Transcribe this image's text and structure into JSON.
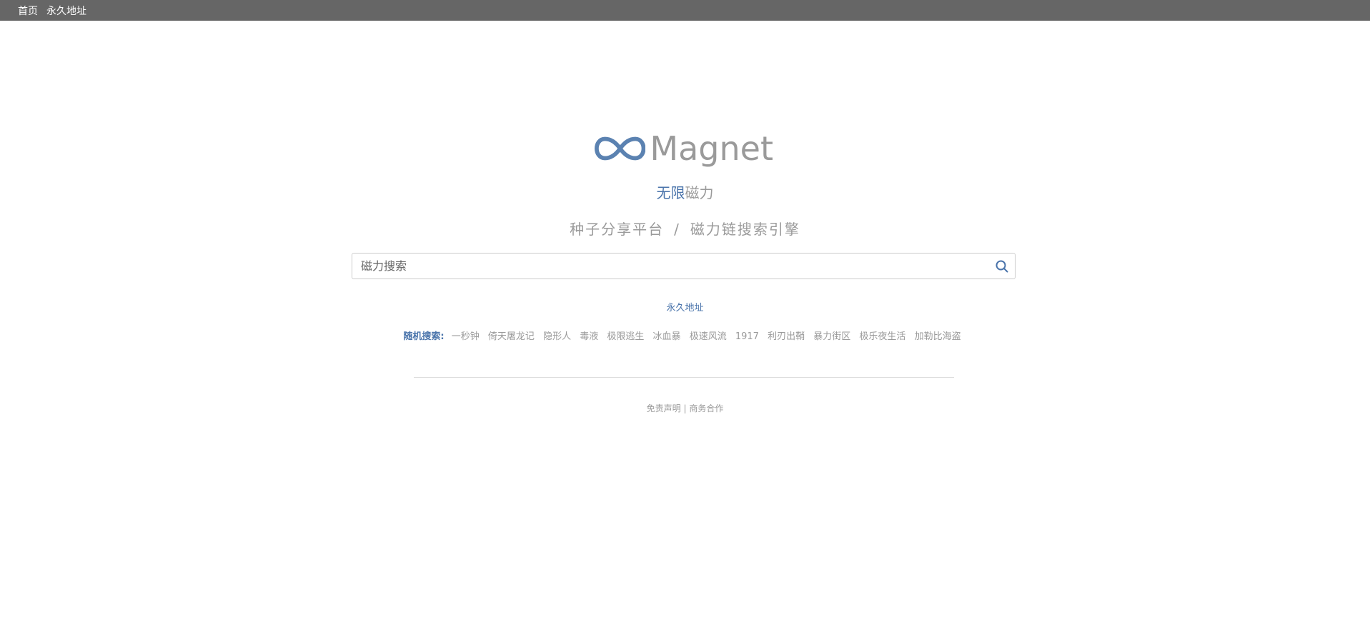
{
  "topbar": {
    "links": [
      "首页",
      "永久地址"
    ]
  },
  "logo": {
    "text": "Magnet",
    "icon": "infinity-icon",
    "icon_color": "#5b82b1"
  },
  "slogan": {
    "part1": "无限",
    "part2": "磁力"
  },
  "tagline": {
    "left": "种子分享平台",
    "separator": "/",
    "right": "磁力链搜索引擎"
  },
  "search": {
    "placeholder": "磁力搜索",
    "icon": "search-icon"
  },
  "permanent_link": "永久地址",
  "random_search": {
    "label": "随机搜索:",
    "items": [
      "一秒钟",
      "倚天屠龙记",
      "隐形人",
      "毒液",
      "极限逃生",
      "冰血暴",
      "极速风流",
      "1917",
      "利刃出鞘",
      "暴力街区",
      "极乐夜生活",
      "加勒比海盗"
    ]
  },
  "footer": {
    "disclaimer": "免责声明",
    "separator": "|",
    "business": "商务合作"
  },
  "colors": {
    "topbar_bg": "#666666",
    "accent_blue": "#4a74ab",
    "grey_text": "#9a9a9a"
  }
}
